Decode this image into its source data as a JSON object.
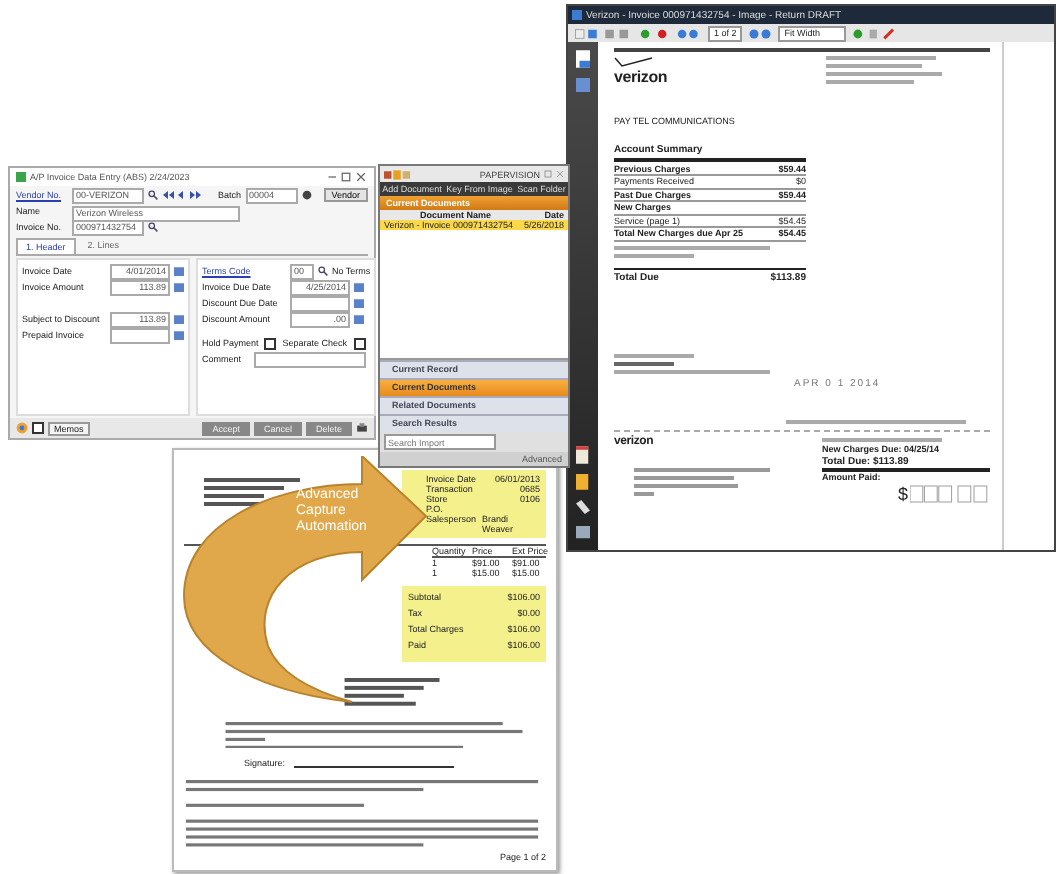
{
  "viewer": {
    "title": "Verizon - Invoice 000971432754 - Image - Return DRAFT",
    "page_box": "1 of 2",
    "zoom": "Fit Width",
    "bill": {
      "logo": "verizon",
      "customer": "PAY TEL COMMUNICATIONS",
      "summary_title": "Account Summary",
      "lines": [
        {
          "label": "Previous Charges",
          "amount": "$59.44",
          "bold": true
        },
        {
          "label": "Payments Received",
          "amount": "$0",
          "bold": false
        },
        {
          "label": "Past Due Charges",
          "amount": "$59.44",
          "bold": true
        },
        {
          "label": "New Charges",
          "bold": true
        },
        {
          "label": "Service (page 1)",
          "amount": "$54.45",
          "bold": false
        },
        {
          "label": "Total New Charges due Apr 25",
          "amount": "$54.45",
          "bold": true
        }
      ],
      "total_label": "Total Due",
      "total_amount": "$113.89",
      "stamp": "APR 0 1 2014",
      "stub_logo": "verizon",
      "stub": [
        "New Charges Due: 04/25/14",
        "Total Due: $113.89",
        "Amount Paid:"
      ],
      "dollar": "$"
    }
  },
  "ap_window": {
    "title": "A/P Invoice Data Entry (ABS) 2/24/2023",
    "top_fields": [
      {
        "label": "Vendor No.",
        "value": "00-VERIZON",
        "link": true
      },
      {
        "label": "Name",
        "value": "Verizon Wireless",
        "link": false
      },
      {
        "label": "Invoice No.",
        "value": "000971432754",
        "link": false
      }
    ],
    "batch_label": "Batch",
    "batch_value": "00004",
    "vendor_button": "Vendor",
    "tabs": [
      {
        "label": "1. Header",
        "selected": true
      },
      {
        "label": "2. Lines",
        "selected": false
      }
    ],
    "left_fields": [
      {
        "label": "Invoice Date",
        "value": "4/01/2014",
        "link": false
      },
      {
        "label": "Invoice Amount",
        "value": "113.89",
        "link": false
      },
      {
        "label": "Subject to Discount",
        "value": "113.89",
        "link": false
      },
      {
        "label": "Prepaid Invoice",
        "link": false
      }
    ],
    "terms_label": "Terms Code",
    "terms_value": "00",
    "terms_note": "No Terms",
    "right_fields": [
      {
        "label": "Invoice Due Date",
        "value": "4/25/2014",
        "link": false
      },
      {
        "label": "Discount Due Date",
        "link": false
      },
      {
        "label": "Discount Amount",
        "value": ".00",
        "link": false
      }
    ],
    "checks": [
      {
        "label": "Hold Payment",
        "checked": false
      },
      {
        "label": "Separate Check",
        "checked": false
      }
    ],
    "comment_label": "Comment",
    "footer_check": {
      "label": "Memos",
      "checked": false
    },
    "buttons": [
      "Accept",
      "Cancel",
      "Delete"
    ]
  },
  "doc_panel": {
    "title": "PAPERVISION",
    "actions": [
      "Add Document",
      "Key From Image",
      "Scan Folder"
    ],
    "header": "Current Documents",
    "columns": [
      "Document Name",
      "Date"
    ],
    "rows": [
      {
        "name": "Verizon - Invoice 000971432754",
        "date": "5/26/2018",
        "selected": true
      }
    ],
    "sections": [
      {
        "label": "Current Record",
        "selected": false
      },
      {
        "label": "Current Documents",
        "selected": true
      },
      {
        "label": "Related Documents",
        "selected": false
      },
      {
        "label": "Search Results",
        "selected": false
      }
    ],
    "search": {
      "placeholder": "Search Import"
    },
    "footer": "Advanced"
  },
  "scan": {
    "info": [
      {
        "label": "Invoice Date",
        "value": "06/01/2013"
      },
      {
        "label": "Transaction",
        "value": "0685"
      },
      {
        "label": "Store",
        "value": "0106"
      },
      {
        "label": "P.O."
      },
      {
        "label": "Salesperson",
        "value": "Brandi Weaver"
      }
    ],
    "columns": [
      "Quantity",
      "Price",
      "Ext Price"
    ],
    "rows": [
      {
        "qty": "1",
        "price": "$91.00",
        "ext": "$91.00"
      },
      {
        "qty": "1",
        "price": "$15.00",
        "ext": "$15.00"
      }
    ],
    "totals": [
      {
        "label": "Subtotal",
        "value": "$106.00"
      },
      {
        "label": "Tax",
        "value": "$0.00"
      },
      {
        "label": "Total Charges",
        "value": "$106.00"
      },
      {
        "label": "Paid",
        "value": "$106.00"
      }
    ],
    "signature_label": "Signature:",
    "page": "Page 1 of 2"
  },
  "arrow_label": "Advanced Capture Automation"
}
